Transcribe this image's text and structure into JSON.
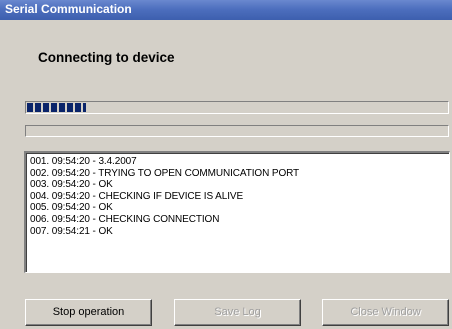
{
  "window": {
    "title": "Serial Communication"
  },
  "heading": "Connecting to device",
  "progress": {
    "primary_fraction": 0.14,
    "secondary_fraction": 0.0
  },
  "log": {
    "lines": [
      "001. 09:54:20 - 3.4.2007",
      "002. 09:54:20 - TRYING TO OPEN COMMUNICATION PORT",
      "003. 09:54:20 - OK",
      "004. 09:54:20 - CHECKING IF DEVICE IS ALIVE",
      "005. 09:54:20 - OK",
      "006. 09:54:20 - CHECKING CONNECTION",
      "007. 09:54:21 - OK"
    ]
  },
  "buttons": {
    "stop": "Stop operation",
    "save_log": "Save Log",
    "close_window": "Close Window"
  },
  "colors": {
    "titlebar": "#4d6fbe",
    "progress_fill": "#0a246a",
    "dialog_bg": "#d4d0c8"
  }
}
